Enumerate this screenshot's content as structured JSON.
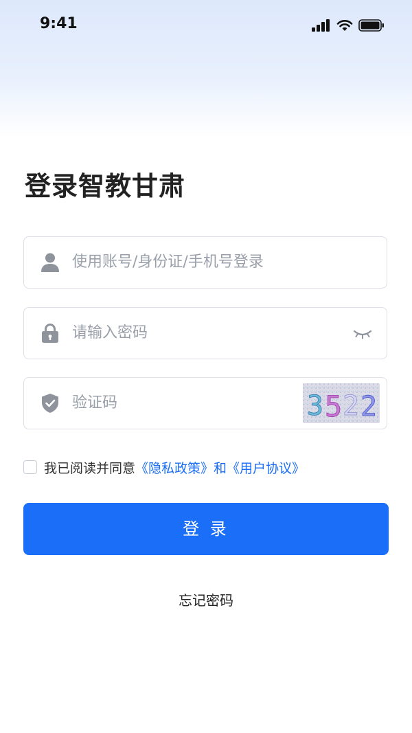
{
  "status_bar": {
    "time": "9:41"
  },
  "title": "登录智教甘肃",
  "fields": {
    "account": {
      "placeholder": "使用账号/身份证/手机号登录",
      "icon": "user-icon"
    },
    "password": {
      "placeholder": "请输入密码",
      "icon": "lock-icon",
      "toggle_icon": "eye-closed-icon"
    },
    "captcha": {
      "placeholder": "验证码",
      "icon": "shield-check-icon",
      "code": "3522"
    }
  },
  "agreement": {
    "prefix": "我已阅读并同意",
    "privacy_link": "《隐私政策》",
    "connector": "和",
    "terms_link": "《用户协议》",
    "checked": false
  },
  "login_button": "登 录",
  "forgot_password": "忘记密码",
  "colors": {
    "primary": "#1b6ef8",
    "link": "#1a6df7",
    "placeholder": "#9aa0aa",
    "border": "#dcdfe6",
    "icon": "#8e939c"
  }
}
